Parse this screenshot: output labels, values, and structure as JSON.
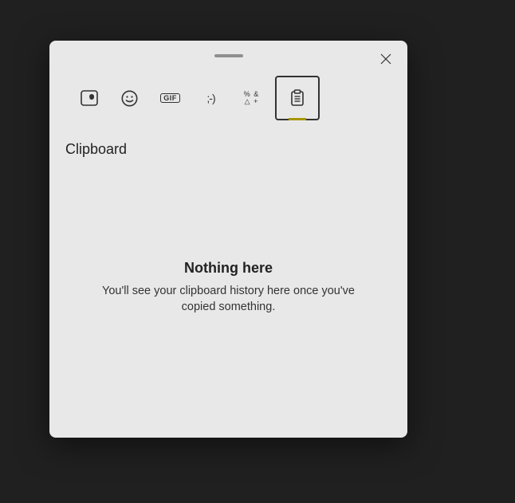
{
  "panel": {
    "section_title": "Clipboard",
    "empty_title": "Nothing here",
    "empty_desc": "You'll see your clipboard history here once you've copied something."
  },
  "tabs": {
    "recent_label": "Recent",
    "emoji_label": "Emoji",
    "gif_label": "GIF",
    "kaomoji_label": "Kaomoji",
    "kaomoji_sample": ";-)",
    "symbols_label": "Symbols",
    "clipboard_label": "Clipboard"
  },
  "icons": {
    "close": "Close"
  }
}
